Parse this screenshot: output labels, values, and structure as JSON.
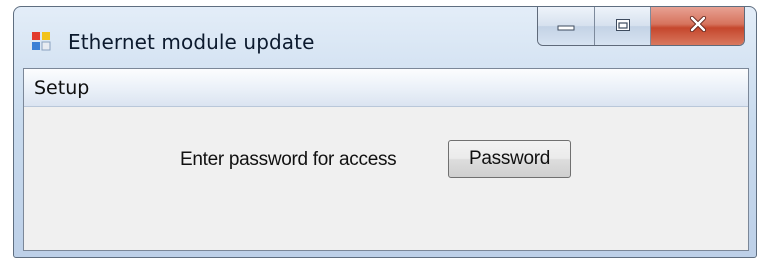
{
  "window": {
    "title": "Ethernet module update",
    "icon": "app-window-icon",
    "controls": {
      "minimize_icon": "minimize-icon",
      "maximize_icon": "maximize-icon",
      "close_icon": "close-icon"
    }
  },
  "menu": {
    "items": [
      {
        "label": "Setup"
      }
    ]
  },
  "content": {
    "prompt": "Enter password for access",
    "password_button": "Password"
  },
  "colors": {
    "close_button": "#c5472d",
    "client_background": "#f0f0f0",
    "title_bar": "#c9dbee"
  }
}
